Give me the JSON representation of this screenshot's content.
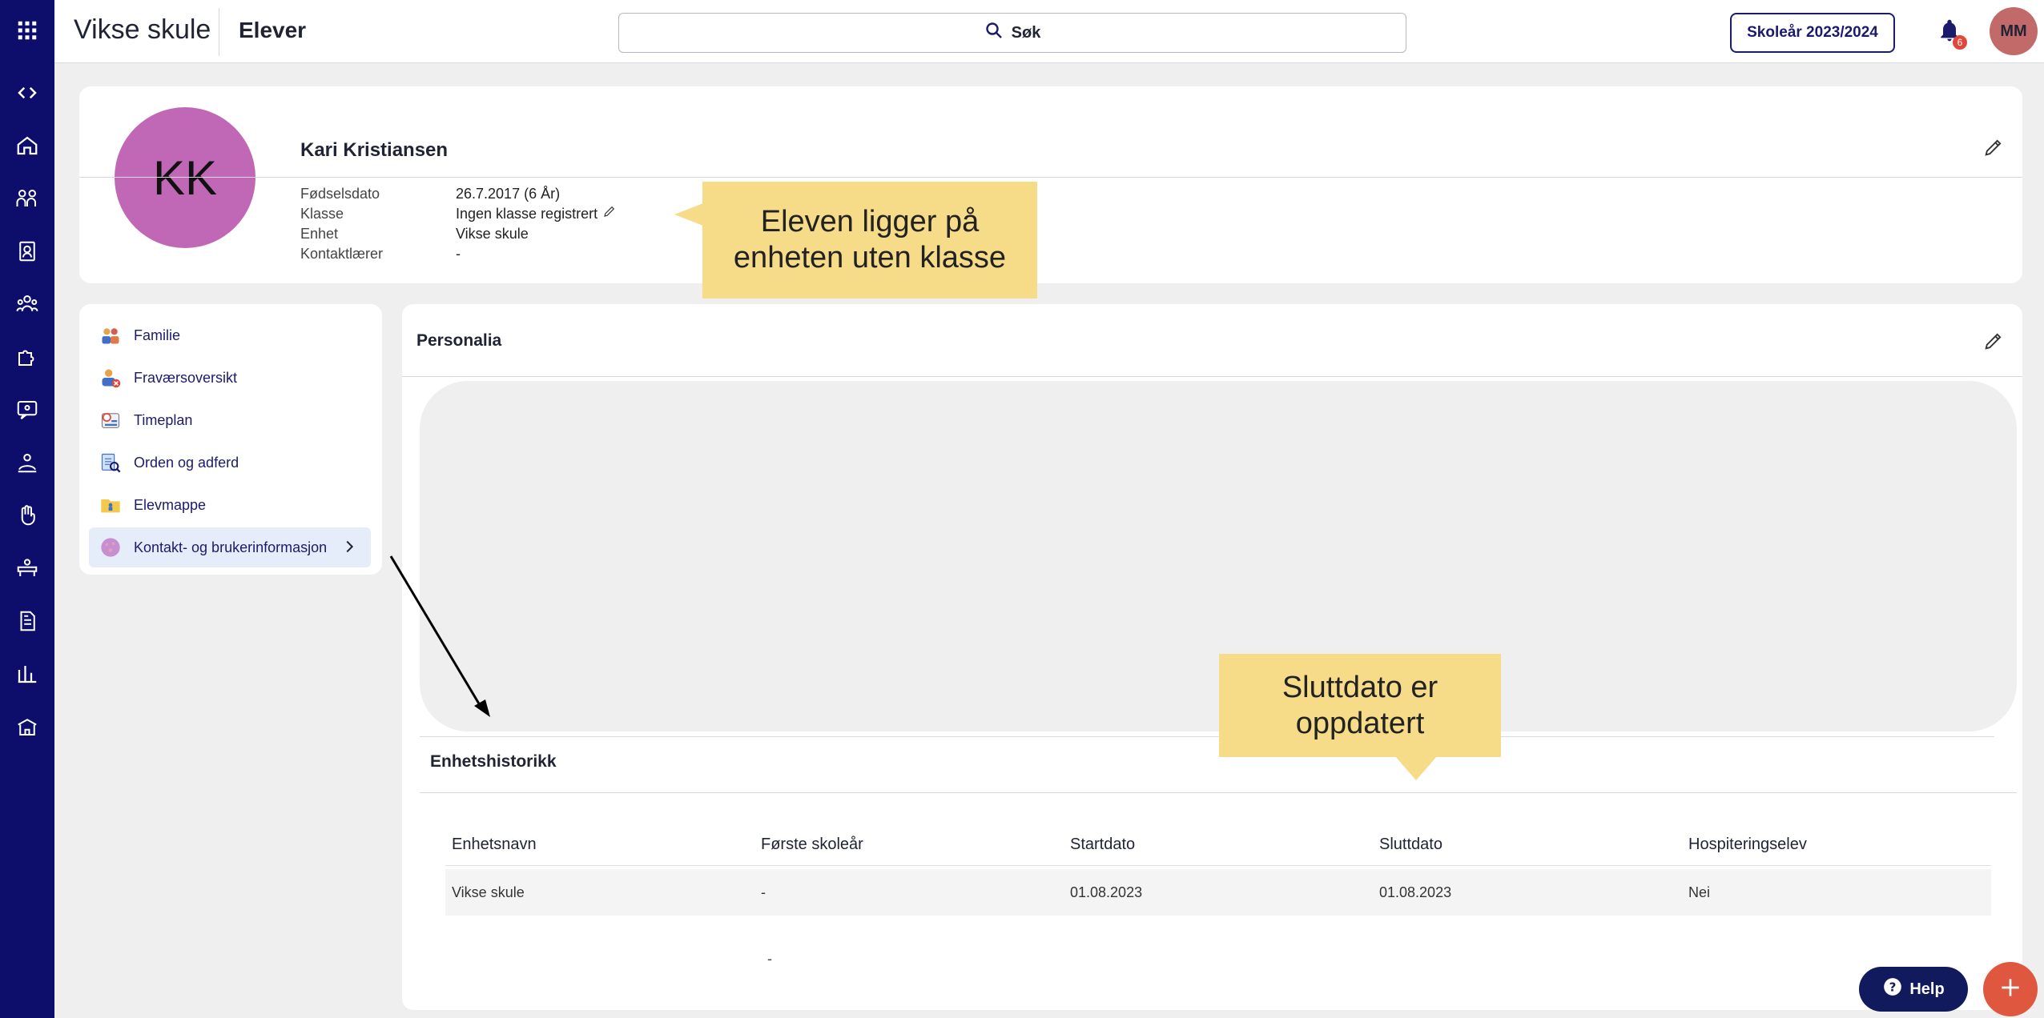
{
  "app": {
    "title": "Vikse skule",
    "page": "Elever"
  },
  "search": {
    "label": "Søk"
  },
  "header": {
    "school_year": "Skoleår 2023/2024",
    "notification_count": "6",
    "user_initials": "MM"
  },
  "student": {
    "initials": "KK",
    "name": "Kari Kristiansen",
    "fields": [
      {
        "label": "Fødselsdato",
        "value": "26.7.2017 (6 År)"
      },
      {
        "label": "Klasse",
        "value": "Ingen klasse registrert"
      },
      {
        "label": "Enhet",
        "value": "Vikse skule"
      },
      {
        "label": "Kontaktlærer",
        "value": "-"
      }
    ]
  },
  "menu": {
    "items": [
      {
        "label": "Familie",
        "icon": "family-icon"
      },
      {
        "label": "Fraværsoversikt",
        "icon": "absence-icon"
      },
      {
        "label": "Timeplan",
        "icon": "schedule-icon"
      },
      {
        "label": "Orden og adferd",
        "icon": "behavior-icon"
      },
      {
        "label": "Elevmappe",
        "icon": "folder-icon"
      },
      {
        "label": "Kontakt- og brukerinformasjon",
        "icon": "contact-icon"
      }
    ]
  },
  "personalia": {
    "title": "Personalia"
  },
  "history": {
    "title": "Enhetshistorikk",
    "columns": [
      "Enhetsnavn",
      "Første skoleår",
      "Startdato",
      "Sluttdato",
      "Hospiteringselev"
    ],
    "rows": [
      [
        "Vikse skule",
        "-",
        "01.08.2023",
        "01.08.2023",
        "Nei"
      ]
    ],
    "trailing_dash": "-"
  },
  "callouts": {
    "class_note": "Eleven ligger på enheten uten klasse",
    "end_date_note": "Sluttdato er oppdatert"
  },
  "help": {
    "label": "Help"
  },
  "colors": {
    "rail": "#0d0d6b",
    "avatar_student": "#c067b5",
    "avatar_user": "#c26a6a",
    "callout": "#f6db88",
    "fab": "#e0573f",
    "help": "#101a5c"
  }
}
